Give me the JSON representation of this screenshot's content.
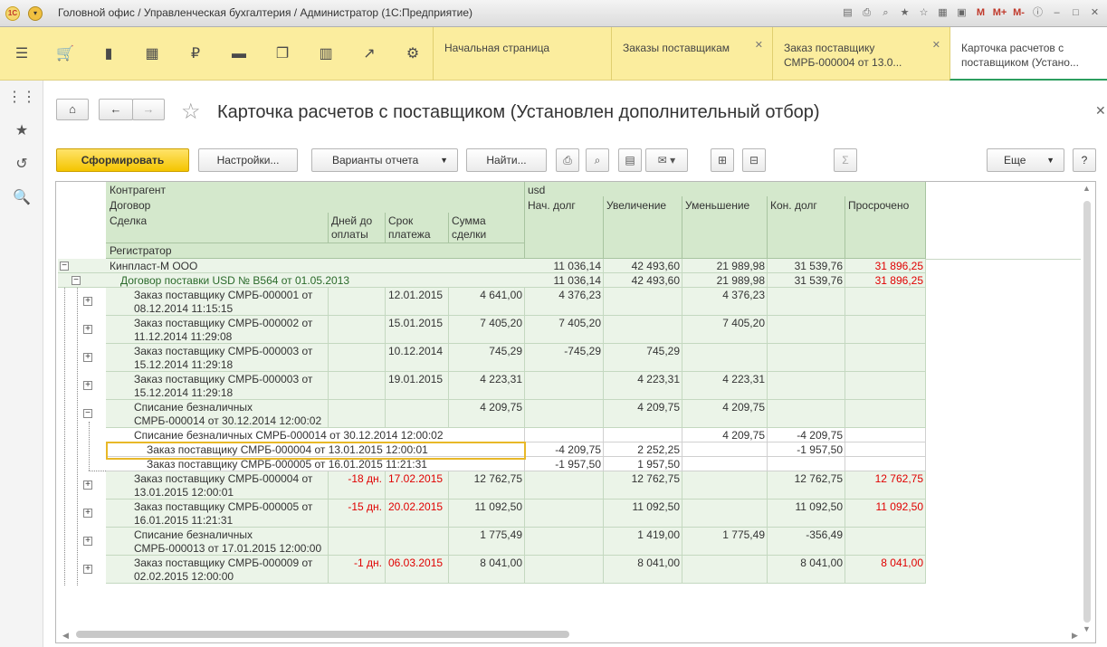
{
  "titlebar": {
    "logo": "1С",
    "title": "Головной офис / Управленческая бухгалтерия / Администратор  (1С:Предприятие)",
    "icons": [
      "save-icon",
      "print-icon",
      "preview-icon",
      "favorites-icon",
      "star-icon",
      "calendar-icon",
      "calendar-31-icon",
      "M",
      "M+",
      "M-",
      "info-icon",
      "minimize-icon",
      "maximize-icon",
      "close-icon"
    ]
  },
  "sections": {
    "icons": [
      "menu-icon",
      "cart-icon",
      "bag-icon",
      "grid-icon",
      "ruble-icon",
      "truck-icon",
      "documents-icon",
      "chart-icon",
      "trend-icon",
      "gear-icon"
    ],
    "tabs": [
      {
        "label": "Начальная страница",
        "closable": false
      },
      {
        "label": "Заказы поставщикам",
        "closable": true
      },
      {
        "label": "Заказ поставщику СМРБ-000004 от 13.0...",
        "closable": true
      },
      {
        "label": "Карточка расчетов с поставщиком (Устано...",
        "closable": true
      }
    ]
  },
  "form": {
    "title": "Карточка расчетов с поставщиком (Установлен дополнительный отбор)",
    "buttons": {
      "generate": "Сформировать",
      "settings": "Настройки...",
      "variants": "Варианты отчета",
      "find": "Найти...",
      "more": "Еще",
      "help": "?"
    }
  },
  "report": {
    "headers": {
      "counterparty": "Контрагент",
      "contract": "Договор",
      "deal": "Сделка",
      "days_to_pay": "Дней до оплаты",
      "due_date": "Срок платежа",
      "deal_sum": "Сумма сделки",
      "registrar": "Регистратор",
      "currency": "usd",
      "start_debt": "Нач. долг",
      "increase": "Увеличение",
      "decrease": "Уменьшение",
      "end_debt": "Кон. долг",
      "overdue": "Просрочено"
    },
    "rows": [
      {
        "name": "Кинпласт-М ООО",
        "start": "11 036,14",
        "inc": "42 493,60",
        "dec": "21 989,98",
        "end": "31 539,76",
        "ovd": "31 896,25"
      },
      {
        "name": "Договор поставки USD № B564 от 01.05.2013",
        "start": "11 036,14",
        "inc": "42 493,60",
        "dec": "21 989,98",
        "end": "31 539,76",
        "ovd": "31 896,25"
      },
      {
        "l1": "Заказ поставщику СМРБ-000001 от",
        "l2": "08.12.2014 11:15:15",
        "days": "",
        "due": "12.01.2015",
        "sum": "4 641,00",
        "start": "4 376,23",
        "inc": "",
        "dec": "4 376,23",
        "end": "",
        "ovd": ""
      },
      {
        "l1": "Заказ поставщику СМРБ-000002 от",
        "l2": "11.12.2014 11:29:08",
        "days": "",
        "due": "15.01.2015",
        "sum": "7 405,20",
        "start": "7 405,20",
        "inc": "",
        "dec": "7 405,20",
        "end": "",
        "ovd": ""
      },
      {
        "l1": "Заказ поставщику СМРБ-000003 от",
        "l2": "15.12.2014 11:29:18",
        "days": "",
        "due": "10.12.2014",
        "sum": "745,29",
        "start": "-745,29",
        "inc": "745,29",
        "dec": "",
        "end": "",
        "ovd": ""
      },
      {
        "l1": "Заказ поставщику СМРБ-000003 от",
        "l2": "15.12.2014 11:29:18",
        "days": "",
        "due": "19.01.2015",
        "sum": "4 223,31",
        "start": "",
        "inc": "4 223,31",
        "dec": "4 223,31",
        "end": "",
        "ovd": ""
      },
      {
        "l1": "Списание безналичных",
        "l2": "СМРБ-000014 от 30.12.2014 12:00:02",
        "days": "",
        "due": "",
        "sum": "4 209,75",
        "start": "",
        "inc": "4 209,75",
        "dec": "4 209,75",
        "end": "",
        "ovd": ""
      },
      {
        "reg": "Списание безналичных СМРБ-000014 от 30.12.2014 12:00:02",
        "start": "",
        "inc": "",
        "dec": "4 209,75",
        "end": "-4 209,75",
        "ovd": ""
      },
      {
        "reg": "Заказ поставщику СМРБ-000004 от 13.01.2015 12:00:01",
        "start": "-4 209,75",
        "inc": "2 252,25",
        "dec": "",
        "end": "-1 957,50",
        "ovd": ""
      },
      {
        "reg": "Заказ поставщику СМРБ-000005 от 16.01.2015 11:21:31",
        "start": "-1 957,50",
        "inc": "1 957,50",
        "dec": "",
        "end": "",
        "ovd": ""
      },
      {
        "l1": "Заказ поставщику СМРБ-000004 от",
        "l2": "13.01.2015 12:00:01",
        "days": "-18 дн.",
        "due": "17.02.2015",
        "sum": "12 762,75",
        "start": "",
        "inc": "12 762,75",
        "dec": "",
        "end": "12 762,75",
        "ovd": "12 762,75"
      },
      {
        "l1": "Заказ поставщику СМРБ-000005 от",
        "l2": "16.01.2015 11:21:31",
        "days": "-15 дн.",
        "due": "20.02.2015",
        "sum": "11 092,50",
        "start": "",
        "inc": "11 092,50",
        "dec": "",
        "end": "11 092,50",
        "ovd": "11 092,50"
      },
      {
        "l1": "Списание безналичных",
        "l2": "СМРБ-000013 от 17.01.2015 12:00:00",
        "days": "",
        "due": "",
        "sum": "1 775,49",
        "start": "",
        "inc": "1 419,00",
        "dec": "1 775,49",
        "end": "-356,49",
        "ovd": ""
      },
      {
        "l1": "Заказ поставщику СМРБ-000009 от",
        "l2": "02.02.2015 12:00:00",
        "days": "-1 дн.",
        "due": "06.03.2015",
        "sum": "8 041,00",
        "start": "",
        "inc": "8 041,00",
        "dec": "",
        "end": "8 041,00",
        "ovd": "8 041,00"
      }
    ]
  }
}
